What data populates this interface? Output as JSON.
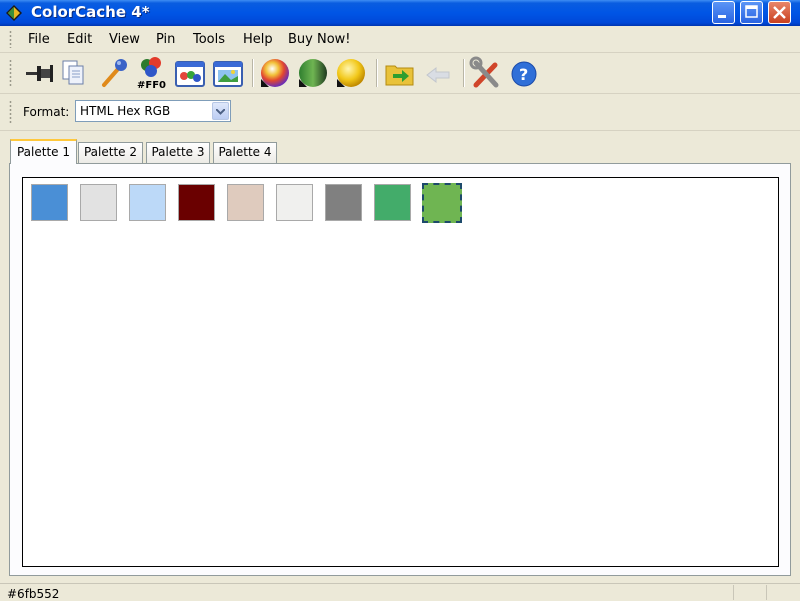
{
  "window": {
    "title": "ColorCache 4*",
    "icon": "colorcache-app-icon"
  },
  "menu": [
    {
      "label": "File"
    },
    {
      "label": "Edit"
    },
    {
      "label": "View"
    },
    {
      "label": "Pin"
    },
    {
      "label": "Tools"
    },
    {
      "label": "Help"
    },
    {
      "label": "Buy Now!"
    }
  ],
  "toolbar": {
    "buttons": [
      {
        "icon": "pin-icon"
      },
      {
        "icon": "copy-icon"
      },
      {
        "icon": "eyedropper-icon"
      },
      {
        "icon": "hex-color-icon",
        "text": "#FF0"
      },
      {
        "icon": "palette-window-icon"
      },
      {
        "icon": "image-window-icon"
      },
      {
        "icon": "color-wheel-icon"
      },
      {
        "icon": "shade-circle-icon"
      },
      {
        "icon": "yellow-circle-icon"
      },
      {
        "icon": "import-folder-icon"
      },
      {
        "icon": "back-arrow-icon"
      },
      {
        "icon": "tools-icon"
      },
      {
        "icon": "help-icon"
      }
    ]
  },
  "format": {
    "label": "Format:",
    "value": "HTML Hex RGB"
  },
  "tabs": [
    {
      "label": "Palette 1",
      "active": true
    },
    {
      "label": "Palette 2",
      "active": false
    },
    {
      "label": "Palette 3",
      "active": false
    },
    {
      "label": "Palette 4",
      "active": false
    }
  ],
  "palette": {
    "swatches": [
      {
        "color": "#4a8fd6"
      },
      {
        "color": "#e2e2e2"
      },
      {
        "color": "#bcd9f8"
      },
      {
        "color": "#6a0000"
      },
      {
        "color": "#dfcbbe"
      },
      {
        "color": "#f0f0ee"
      },
      {
        "color": "#808080"
      },
      {
        "color": "#43ac6a"
      },
      {
        "color": "#6fb552",
        "selected": true
      }
    ]
  },
  "status": {
    "text": "#6fb552"
  },
  "colors": {
    "titlebar": "#0055E5",
    "chrome": "#ECE9D8",
    "active_tab_accent": "#FFC83C"
  }
}
